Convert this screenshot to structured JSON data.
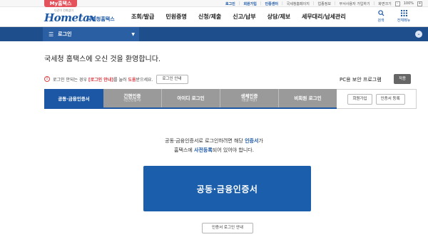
{
  "top_bar": {
    "mytax_label": "My홈택스",
    "links": [
      "로그인",
      "회원가입",
      "인증센터",
      "국세청홈페이지",
      "업종정보",
      "무서사용자 가입하기",
      "화면크기",
      "100%"
    ]
  },
  "header": {
    "slogan": "다같이 전화없이",
    "logo_text": "Hometax",
    "logo_sub": "국세청홈택스",
    "nav": [
      "조회/발급",
      "민원증명",
      "신청/제출",
      "신고/납부",
      "상담/제보",
      "세무대리/납세관리"
    ],
    "search_label": "검색",
    "allmenu_label": "전체메뉴"
  },
  "location": {
    "label": "로그인"
  },
  "welcome": "국세청 홈택스에 오신 것을 환영합니다.",
  "notice": {
    "prefix": "로그인 안되는 경우 ",
    "highlight1": "[로그인 안내]",
    "middle": "를 눌러 ",
    "highlight2": "도움",
    "suffix": "받으세요.",
    "button": "로그인 안내"
  },
  "pc_security": {
    "label": "PC용 보안 프로그램",
    "install_button": "적용"
  },
  "tabs": [
    {
      "label": "공동·금융인증서",
      "sub": "",
      "active": true
    },
    {
      "label": "간편인증",
      "sub": "(민간인증서)",
      "active": false
    },
    {
      "label": "아이디 로그인",
      "sub": "",
      "active": false
    },
    {
      "label": "생체인증",
      "sub": "(얼굴·지문)",
      "active": false
    },
    {
      "label": "비회원 로그인",
      "sub": "",
      "active": false
    }
  ],
  "side_buttons": {
    "join": "회원가입",
    "cert_register": "인증서 등록"
  },
  "description": {
    "line1_a": "공동·금융인증서로 로그인하려면 해당 ",
    "line1_b": "인증서",
    "line1_c": "가",
    "line2_a": "홈택스에 ",
    "line2_b": "사전등록",
    "line2_c": "되어 있어야 합니다."
  },
  "main_button": "공동·금융인증서",
  "guide_button": "인증서 로그인 안내",
  "colors": {
    "brand_blue": "#1b57a5",
    "location_bar": "#1f4e8c",
    "mytax_red": "#e4525b",
    "notice_red": "#d9363e",
    "inactive_tab": "#9a9a9a"
  },
  "icons": {
    "search": "search-icon",
    "allmenu": "grid-menu-icon",
    "warning": "exclamation-icon"
  }
}
